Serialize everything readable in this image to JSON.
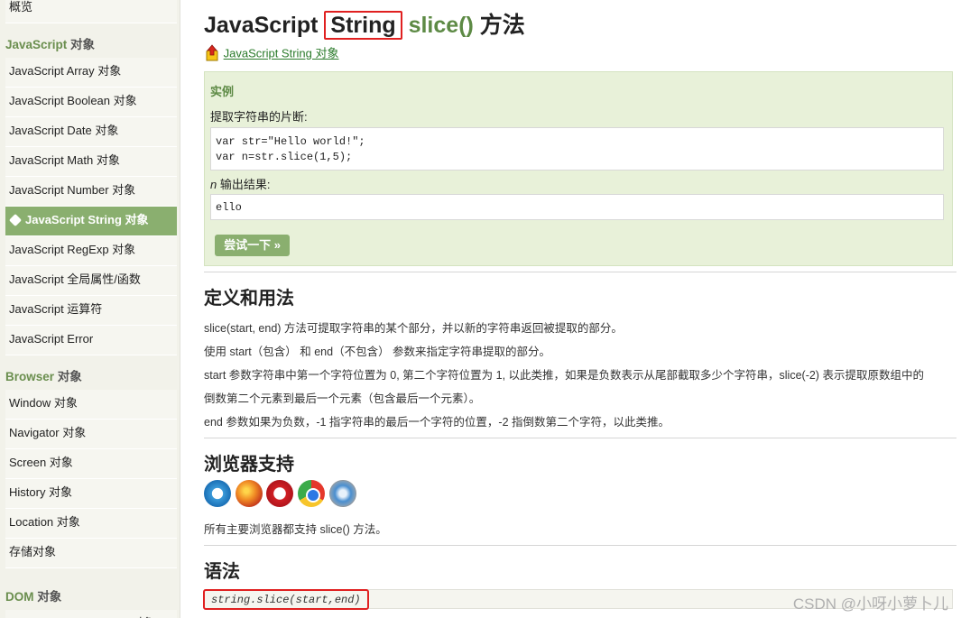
{
  "sidebar": {
    "top_item": "概览",
    "sections": [
      {
        "title_accent": "JavaScript",
        "title_rest": " 对象",
        "items": [
          "JavaScript Array 对象",
          "JavaScript Boolean 对象",
          "JavaScript Date 对象",
          "JavaScript Math 对象",
          "JavaScript Number 对象",
          "JavaScript String 对象",
          "JavaScript RegExp 对象",
          "JavaScript 全局属性/函数",
          "JavaScript 运算符",
          "JavaScript Error"
        ],
        "active_index": 5
      },
      {
        "title_accent": "Browser",
        "title_rest": " 对象",
        "items": [
          "Window 对象",
          "Navigator 对象",
          "Screen 对象",
          "History 对象",
          "Location 对象",
          "存储对象"
        ]
      },
      {
        "title_accent": "DOM",
        "title_rest": " 对象",
        "items": [
          "HTML DOM Document 对象"
        ]
      }
    ]
  },
  "main": {
    "title_prefix": "JavaScript ",
    "title_highlight": "String",
    "title_method": " slice()",
    "title_suffix": " 方法",
    "back_link": "JavaScript String 对象",
    "example": {
      "heading": "实例",
      "description": "提取字符串的片断:",
      "code_lines": [
        "var str=\"Hello world!\";",
        "var n=str.slice(1,5);"
      ],
      "output_var": "n",
      "output_label": " 输出结果:",
      "output": "ello",
      "try_button": "尝试一下 »"
    },
    "definition": {
      "heading": "定义和用法",
      "paragraphs": [
        "slice(start, end) 方法可提取字符串的某个部分，并以新的字符串返回被提取的部分。",
        "使用 start（包含） 和 end（不包含） 参数来指定字符串提取的部分。",
        "start 参数字符串中第一个字符位置为 0, 第二个字符位置为 1, 以此类推，如果是负数表示从尾部截取多少个字符串，slice(-2) 表示提取原数组中的",
        "倒数第二个元素到最后一个元素（包含最后一个元素）。",
        "end 参数如果为负数，-1 指字符串的最后一个字符的位置，-2 指倒数第二个字符，以此类推。"
      ]
    },
    "browser_support": {
      "heading": "浏览器支持",
      "icons": [
        "internet-explorer-icon",
        "firefox-icon",
        "opera-icon",
        "chrome-icon",
        "safari-icon"
      ],
      "note": "所有主要浏览器都支持 slice() 方法。"
    },
    "syntax": {
      "heading": "语法",
      "code": "string.slice(start,end)"
    }
  },
  "watermark": "CSDN @小呀小萝卜儿",
  "colors": {
    "accent_green": "#5d8a45",
    "sidebar_active": "#8aaf6f",
    "highlight_red": "#e02020",
    "example_bg": "#e8f1d9"
  }
}
